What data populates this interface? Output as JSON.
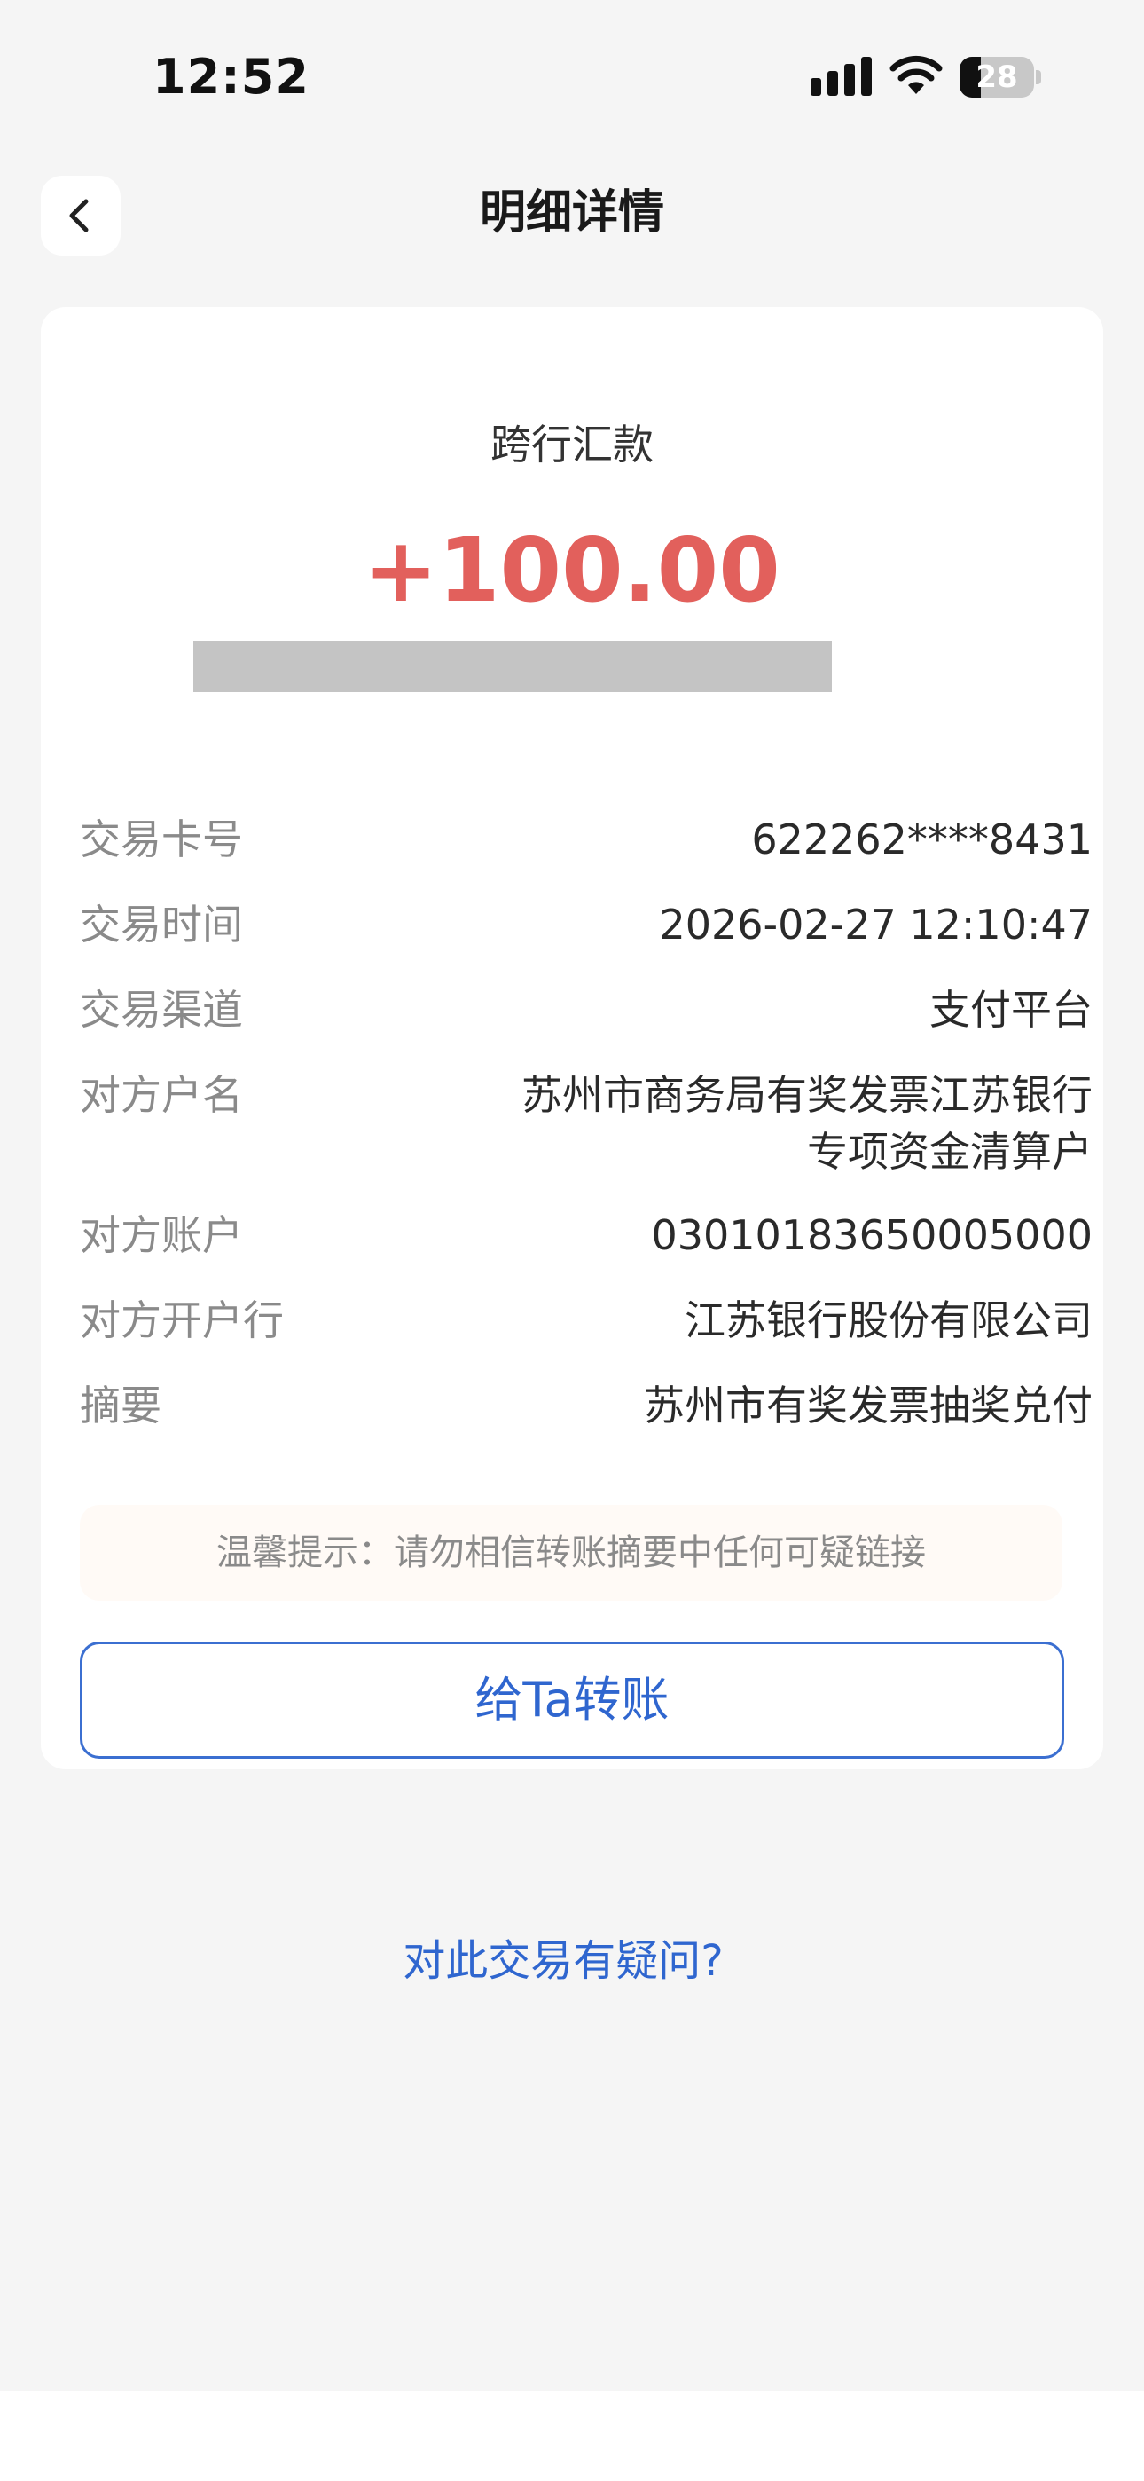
{
  "status_bar": {
    "time": "12:52",
    "battery_level": "28",
    "battery_fraction": 0.28
  },
  "nav": {
    "title": "明细详情",
    "back_icon": "chevron-left-icon"
  },
  "transaction": {
    "type": "跨行汇款",
    "amount": "+100.00",
    "amount_color": "#e2605c"
  },
  "details": [
    {
      "label": "交易卡号",
      "value": "622262****8431"
    },
    {
      "label": "交易时间",
      "value": "2026-02-27 12:10:47"
    },
    {
      "label": "交易渠道",
      "value": "支付平台"
    },
    {
      "label": "对方户名",
      "value": "苏州市商务局有奖发票江苏银行专项资金清算户"
    },
    {
      "label": "对方账户",
      "value": "03010183650005000"
    },
    {
      "label": "对方开户行",
      "value": "江苏银行股份有限公司"
    },
    {
      "label": "摘要",
      "value": "苏州市有奖发票抽奖兑付"
    }
  ],
  "tip": "温馨提示：请勿相信转账摘要中任何可疑链接",
  "actions": {
    "transfer_label": "给Ta转账",
    "question_label": "对此交易有疑问?"
  },
  "colors": {
    "accent": "#2f66cf",
    "amount": "#e2605c",
    "background": "#f5f5f5"
  }
}
